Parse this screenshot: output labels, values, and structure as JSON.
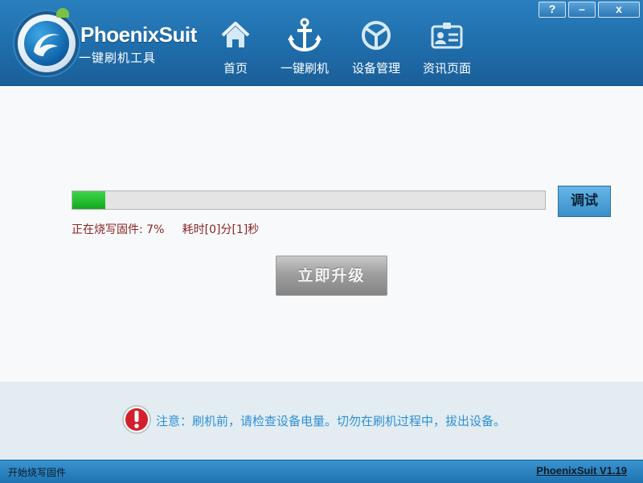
{
  "header": {
    "brand": "PhoenixSuit",
    "subtitle": "一键刷机工具",
    "nav": [
      {
        "label": "首页",
        "icon": "home-icon"
      },
      {
        "label": "一键刷机",
        "icon": "anchor-icon"
      },
      {
        "label": "设备管理",
        "icon": "device-icon"
      },
      {
        "label": "资讯页面",
        "icon": "id-card-icon"
      }
    ],
    "window_buttons": {
      "help": "?",
      "minimize": "–",
      "close": "x"
    }
  },
  "flash": {
    "progress": 0.07,
    "status": "正在烧写固件: 7%     耗时[0]分[1]秒",
    "debug_label": "调试",
    "upgrade_label": "立即升级"
  },
  "notice": {
    "text": "注意：刷机前，请检查设备电量。切勿在刷机过程中，拔出设备。",
    "icon": "warning-icon"
  },
  "statusbar": {
    "left": "开始烧写固件",
    "version": "PhoenixSuit V1.19"
  },
  "colors": {
    "header": "#2177b6",
    "progress_fill": "#1cb326",
    "status_text": "#8b2323",
    "notice_text": "#2f8fd6"
  }
}
